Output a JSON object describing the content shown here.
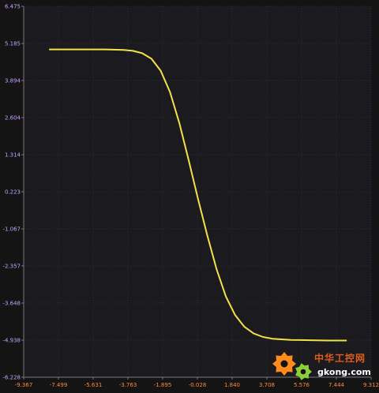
{
  "chart_data": {
    "type": "line",
    "title": "",
    "xlabel": "",
    "ylabel": "",
    "x_ticks": [
      "-9.367",
      "-7.499",
      "-5.631",
      "-3.763",
      "-1.895",
      "-0.028",
      "1.840",
      "3.708",
      "5.576",
      "7.444",
      "9.312"
    ],
    "y_ticks": [
      "6.475",
      "5.185",
      "3.894",
      "2.604",
      "1.314",
      "0.223",
      "-1.067",
      "-2.357",
      "-3.648",
      "-4.938",
      "-6.228"
    ],
    "xlim": [
      -9.367,
      9.312
    ],
    "ylim": [
      -6.228,
      6.475
    ],
    "grid": true,
    "line_color": "#f2e24a",
    "series": [
      {
        "x": [
          -8.0,
          -7.0,
          -6.0,
          -5.0,
          -4.0,
          -3.5,
          -3.0,
          -2.5,
          -2.0,
          -1.5,
          -1.0,
          -0.5,
          0.0,
          0.5,
          1.0,
          1.5,
          2.0,
          2.5,
          3.0,
          3.5,
          4.0,
          5.0,
          6.0,
          7.0,
          8.0
        ],
        "values": [
          5.0,
          5.0,
          5.0,
          5.0,
          4.98,
          4.95,
          4.87,
          4.68,
          4.27,
          3.54,
          2.48,
          1.21,
          -0.1,
          -1.36,
          -2.52,
          -3.46,
          -4.1,
          -4.5,
          -4.73,
          -4.85,
          -4.91,
          -4.95,
          -4.96,
          -4.97,
          -4.97
        ]
      }
    ]
  },
  "watermark": {
    "cn_text": "中华工控网",
    "site": "gkong.com",
    "gear_color": "#ff8c1a",
    "gear2_color": "#8ccf3a"
  }
}
